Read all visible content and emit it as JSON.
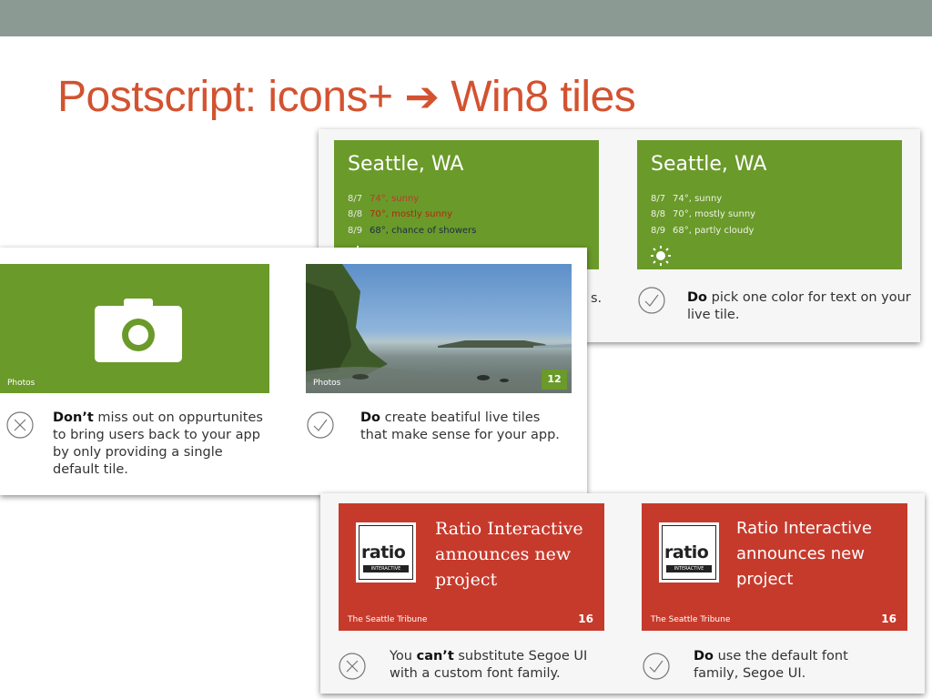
{
  "slide": {
    "title": "Postscript: icons+",
    "arrow_glyph": "➔",
    "title_suffix": "Win8 tiles"
  },
  "weather": {
    "city": "Seattle, WA",
    "bad": {
      "rows": [
        {
          "date": "8/7",
          "text": "74°, sunny"
        },
        {
          "date": "8/8",
          "text": "70°, mostly sunny"
        },
        {
          "date": "8/9",
          "text": "68°, chance of showers"
        }
      ],
      "note_tail": "s."
    },
    "good": {
      "rows": [
        {
          "date": "8/7",
          "text": "74°, sunny"
        },
        {
          "date": "8/8",
          "text": "70°, mostly sunny"
        },
        {
          "date": "8/9",
          "text": "68°, partly cloudy"
        }
      ],
      "note_bold": "Do",
      "note_rest": " pick one color for text on your live tile."
    }
  },
  "photos": {
    "label": "Photos",
    "badge_count": "12",
    "dont_bold": "Don’t",
    "dont_rest": " miss out on oppurtunites to bring users back to your app by only providing a single default tile.",
    "do_bold": "Do",
    "do_rest": " create beatiful live tiles that make sense for your app."
  },
  "news": {
    "headline": [
      "Ratio Interactive",
      "announces new",
      "project"
    ],
    "source": "The Seattle Tribune",
    "count": "16",
    "logo_text": "ratio",
    "logo_sub": "INTERACTIVE",
    "cant_pre": "You ",
    "cant_bold": "can’t",
    "cant_rest": " substitute Segoe UI with a custom font family.",
    "do_bold": "Do",
    "do_rest": " use the default font family, Segoe UI."
  },
  "colors": {
    "title": "#d35230",
    "tile_green": "#6a9a2a",
    "tile_red": "#c63a2c",
    "bad_text_red": "#c0392b",
    "bad_text_navy": "#1e2a44"
  }
}
